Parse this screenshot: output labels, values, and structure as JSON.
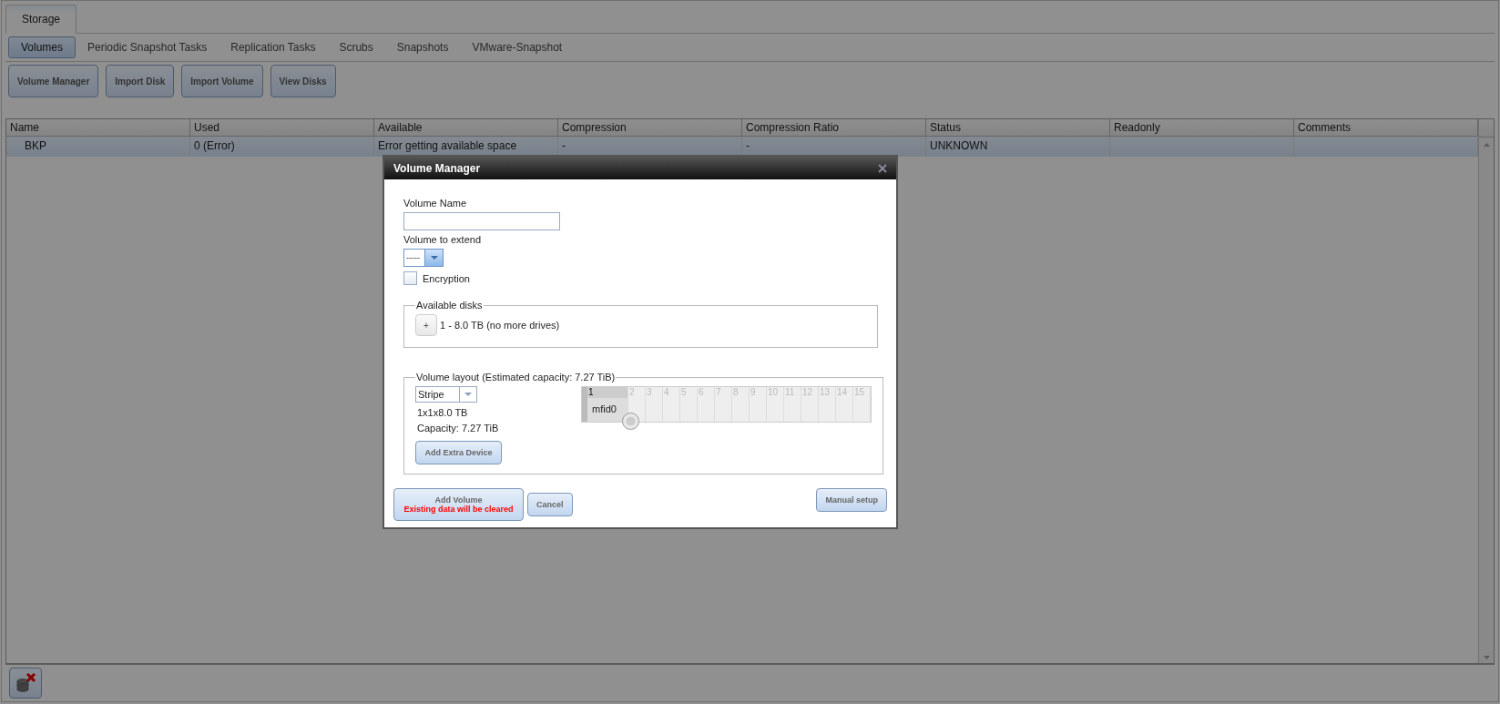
{
  "top_tabs": [
    "Storage"
  ],
  "sub_tabs": [
    {
      "label": "Volumes",
      "selected": true
    },
    {
      "label": "Periodic Snapshot Tasks",
      "selected": false
    },
    {
      "label": "Replication Tasks",
      "selected": false
    },
    {
      "label": "Scrubs",
      "selected": false
    },
    {
      "label": "Snapshots",
      "selected": false
    },
    {
      "label": "VMware-Snapshot",
      "selected": false
    }
  ],
  "toolbar": [
    "Volume Manager",
    "Import Disk",
    "Import Volume",
    "View Disks"
  ],
  "table": {
    "columns": [
      "Name",
      "Used",
      "Available",
      "Compression",
      "Compression Ratio",
      "Status",
      "Readonly",
      "Comments"
    ],
    "rows": [
      {
        "selected": true,
        "cells": [
          "BKP",
          "0 (Error)",
          "Error getting available space",
          "-",
          "-",
          "UNKNOWN"
        ]
      }
    ]
  },
  "dialog": {
    "title": "Volume Manager",
    "volume_name_label": "Volume Name",
    "extend_label": "Volume to extend",
    "extend_value": "-----",
    "encryption": {
      "label": "Encryption",
      "checked": false
    },
    "available_disks": {
      "legend": "Available disks",
      "add_button": "+",
      "text": "1 - 8.0 TB (no more drives)"
    },
    "layout": {
      "legend": "Volume layout (Estimated capacity: 7.27 TiB)",
      "type": "Stripe",
      "geometry": "1x1x8.0 TB",
      "capacity": "Capacity: 7.27 TiB",
      "add_extra_button": "Add Extra Device",
      "grid_columns": [
        "1",
        "2",
        "3",
        "4",
        "5",
        "6",
        "7",
        "8",
        "9",
        "10",
        "11",
        "12",
        "13",
        "14",
        "15"
      ],
      "disks": [
        "mfid0"
      ]
    },
    "add_volume": "Add Volume",
    "warning": "Existing data will be cleared",
    "cancel": "Cancel",
    "manual": "Manual setup"
  }
}
